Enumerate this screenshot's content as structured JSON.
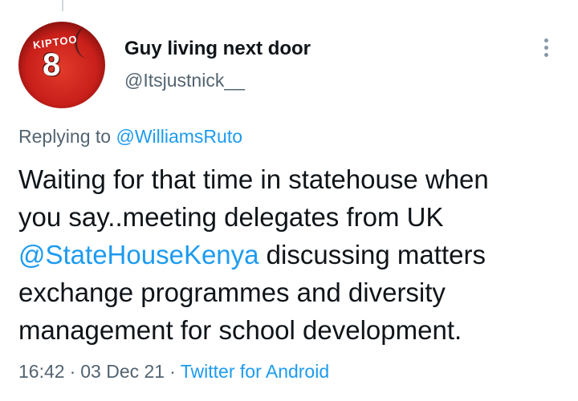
{
  "tweet": {
    "author": {
      "display_name": "Guy living next door",
      "handle": "@Itsjustnick__",
      "avatar": {
        "shirt_name": "KIPTOO",
        "shirt_number": "8"
      }
    },
    "reply": {
      "prefix": "Replying to",
      "to_handle": "@WilliamsRuto"
    },
    "text": {
      "line1": "Waiting for that time in statehouse when",
      "line2": "you say..meeting delegates from UK",
      "mention": "@StateHouseKenya",
      "line3_rest": " discussing matters",
      "line4": "exchange programmes and diversity",
      "line5": "management for school development."
    },
    "meta": {
      "time": "16:42",
      "separator": "·",
      "date": "03 Dec 21",
      "source": "Twitter for Android"
    }
  },
  "icons": {
    "more": "more-vertical-icon"
  },
  "colors": {
    "link": "#1d9bf0",
    "secondary_text": "#536471",
    "primary_text": "#0f1419"
  }
}
